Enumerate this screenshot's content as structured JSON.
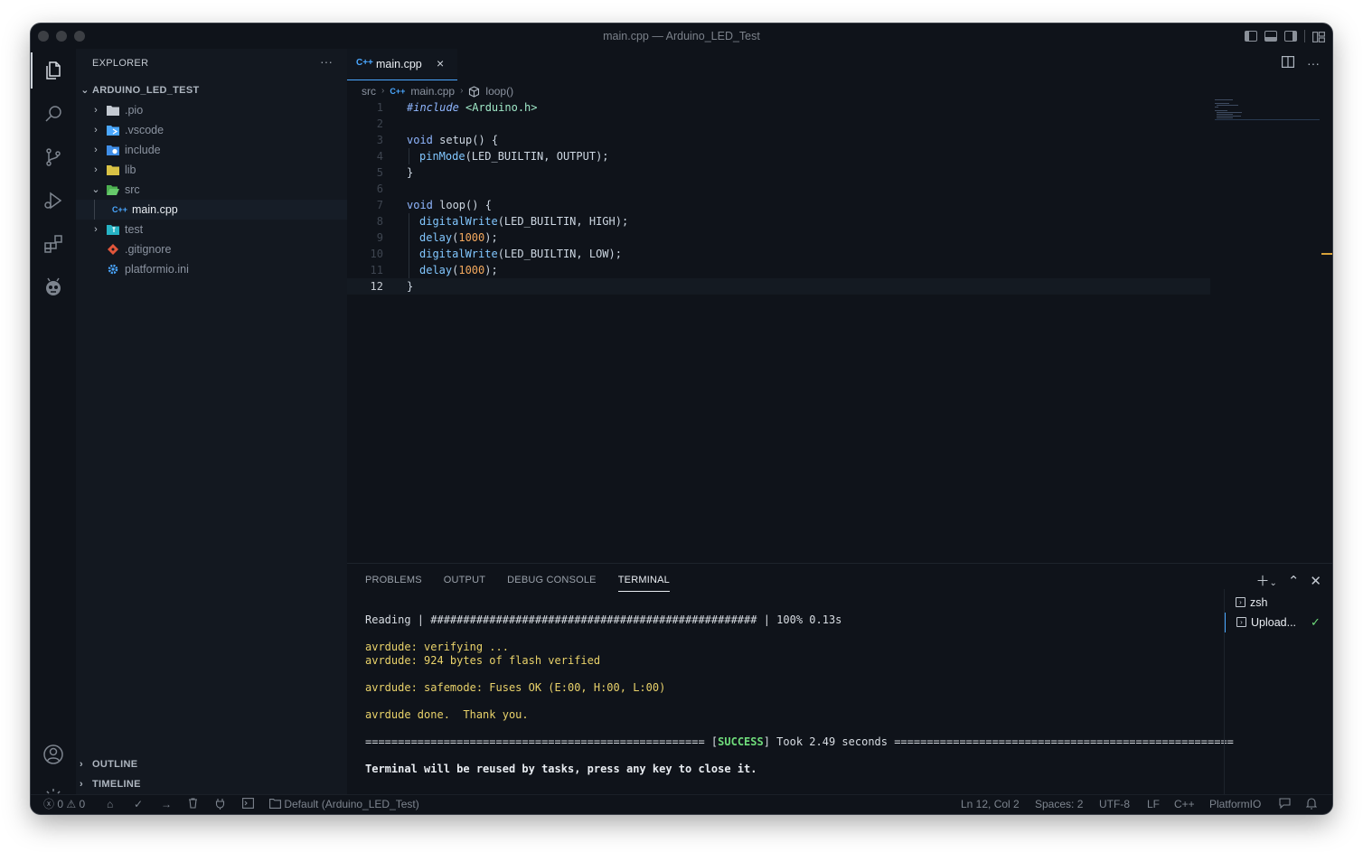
{
  "window": {
    "title": "main.cpp — Arduino_LED_Test"
  },
  "activity_bar": {
    "items": [
      "explorer-icon",
      "search-icon",
      "source-control-icon",
      "run-debug-icon",
      "extensions-icon",
      "platformio-icon"
    ],
    "bottom": [
      "account-icon",
      "settings-gear-icon"
    ]
  },
  "explorer": {
    "header": "EXPLORER",
    "more": "···",
    "project": "ARDUINO_LED_TEST",
    "items": [
      {
        "label": ".pio"
      },
      {
        "label": ".vscode"
      },
      {
        "label": "include"
      },
      {
        "label": "lib"
      },
      {
        "label": "src"
      },
      {
        "label": "main.cpp",
        "badge": "C++"
      },
      {
        "label": "test"
      },
      {
        "label": ".gitignore"
      },
      {
        "label": "platformio.ini"
      }
    ],
    "outline": "OUTLINE",
    "timeline": "TIMELINE"
  },
  "editor": {
    "tab": {
      "badge": "C++",
      "label": "main.cpp",
      "close": "×"
    },
    "breadcrumb": {
      "folder": "src",
      "file_badge": "C++",
      "file": "main.cpp",
      "symbol": "loop()"
    },
    "line_numbers": [
      "1",
      "2",
      "3",
      "4",
      "5",
      "6",
      "7",
      "8",
      "9",
      "10",
      "11",
      "12"
    ],
    "current_line": 12,
    "code": {
      "l1_directive": "#include",
      "l1_header": "<Arduino.h>",
      "l3_kw": "void",
      "l3_rest": " setup() {",
      "l4_fn": "pinMode",
      "l4_args": "(LED_BUILTIN, OUTPUT);",
      "l5": "}",
      "l7_kw": "void",
      "l7_rest": " loop() {",
      "l8_fn": "digitalWrite",
      "l8_args": "(LED_BUILTIN, HIGH);",
      "l9_fn": "delay",
      "l9_open": "(",
      "l9_num": "1000",
      "l9_close": ");",
      "l10_fn": "digitalWrite",
      "l10_args": "(LED_BUILTIN, LOW);",
      "l11_fn": "delay",
      "l11_open": "(",
      "l11_num": "1000",
      "l11_close": ");",
      "l12": "}"
    }
  },
  "panel": {
    "tabs": [
      "PROBLEMS",
      "OUTPUT",
      "DEBUG CONSOLE",
      "TERMINAL"
    ],
    "active_tab": "TERMINAL",
    "terminal_lines": {
      "reading": "Reading | ################################################## | 100% 0.13s",
      "verifying": "avrdude: verifying ...",
      "verified": "avrdude: 924 bytes of flash verified",
      "safemode": "avrdude: safemode: Fuses OK (E:00, H:00, L:00)",
      "done": "avrdude done.  Thank you.",
      "success_left": "==================================================== [",
      "success_word": "SUCCESS",
      "success_right": "] Took 2.49 seconds ====================================================",
      "reuse": "Terminal will be reused by tasks, press any key to close it."
    },
    "terminals": [
      {
        "label": "zsh"
      },
      {
        "label": "Upload..."
      }
    ]
  },
  "statusbar": {
    "errors": "0",
    "warnings": "0",
    "env": "Default (Arduino_LED_Test)",
    "position": "Ln 12, Col 2",
    "spaces": "Spaces: 2",
    "encoding": "UTF-8",
    "eol": "LF",
    "language": "C++",
    "platform": "PlatformIO"
  },
  "colors": {
    "background": "#0f131a",
    "accent": "#4aa7ff",
    "success": "#6fdc7b",
    "terminal_yellow": "#e9d26a",
    "number": "#f3a85d"
  }
}
